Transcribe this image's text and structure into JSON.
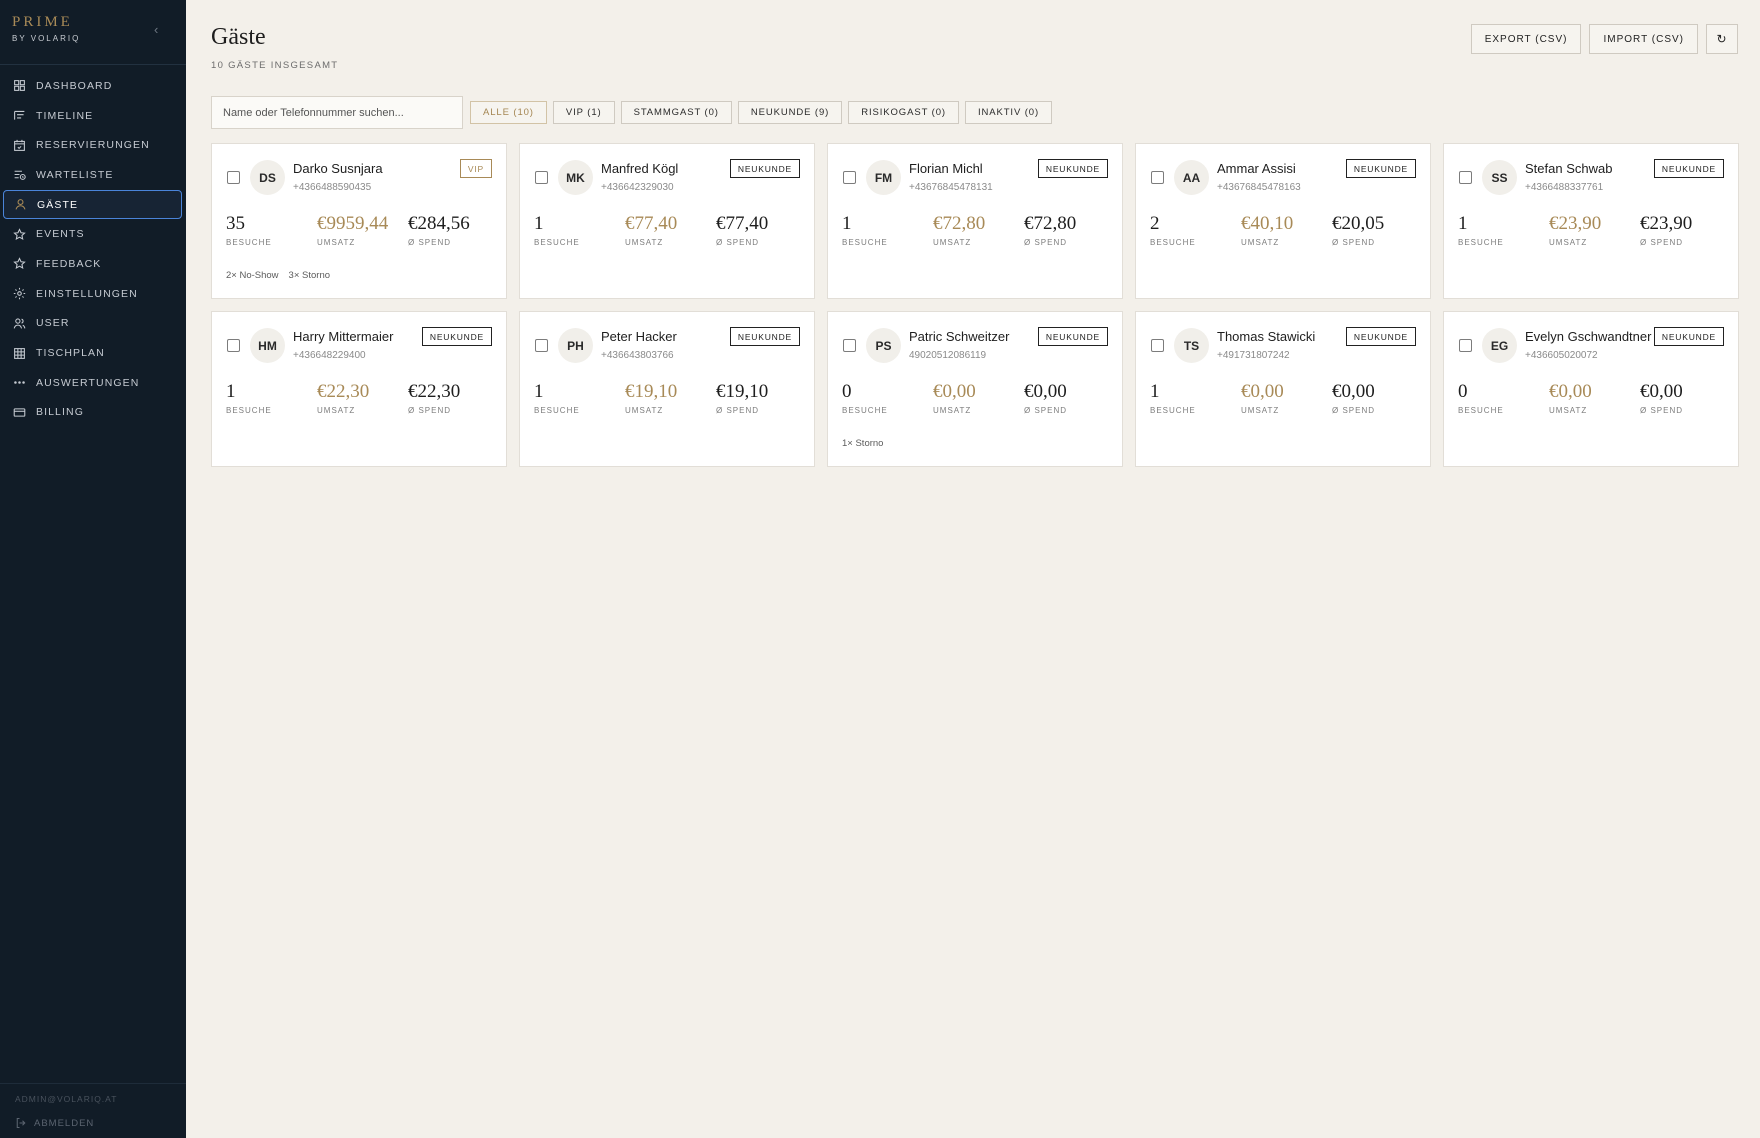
{
  "brand": {
    "name": "PRIME",
    "sub": "BY VOLARIQ"
  },
  "sidebar": {
    "collapse": "‹",
    "items": [
      {
        "label": "DASHBOARD",
        "icon": "grid-icon"
      },
      {
        "label": "TIMELINE",
        "icon": "timeline-icon"
      },
      {
        "label": "RESERVIERUNGEN",
        "icon": "calendar-icon"
      },
      {
        "label": "WARTELISTE",
        "icon": "list-clock-icon"
      },
      {
        "label": "GÄSTE",
        "icon": "user-icon",
        "active": true
      },
      {
        "label": "EVENTS",
        "icon": "star-icon"
      },
      {
        "label": "FEEDBACK",
        "icon": "star-icon"
      },
      {
        "label": "EINSTELLUNGEN",
        "icon": "gear-icon"
      },
      {
        "label": "USER",
        "icon": "users-icon"
      },
      {
        "label": "TISCHPLAN",
        "icon": "table-grid-icon"
      },
      {
        "label": "AUSWERTUNGEN",
        "icon": "dots-icon"
      },
      {
        "label": "BILLING",
        "icon": "credit-card-icon"
      }
    ],
    "email": "ADMIN@VOLARIQ.AT",
    "logout": "ABMELDEN"
  },
  "header": {
    "title": "Gäste",
    "subtitle": "10 GÄSTE INSGESAMT",
    "export": "EXPORT (CSV)",
    "import": "IMPORT (CSV)",
    "refresh": "↻"
  },
  "search": {
    "placeholder": "Name oder Telefonnummer suchen...",
    "value": ""
  },
  "filters": [
    {
      "label": "ALLE (10)",
      "active": true
    },
    {
      "label": "VIP (1)"
    },
    {
      "label": "STAMMGAST (0)"
    },
    {
      "label": "NEUKUNDE (9)"
    },
    {
      "label": "RISIKOGAST (0)"
    },
    {
      "label": "INAKTIV (0)"
    }
  ],
  "labels": {
    "visits": "BESUCHE",
    "revenue": "UMSATZ",
    "spend": "Ø SPEND"
  },
  "colors": {
    "sidebar": "#111c27",
    "accent_gold": "#a88a57",
    "background": "#f3f0ea",
    "active_border": "#4a84d9"
  },
  "guests": [
    {
      "initials": "DS",
      "name": "Darko Susnjara",
      "phone": "+4366488590435",
      "badge": "VIP",
      "visits": "35",
      "revenue": "€9959,44",
      "spend": "€284,56",
      "notes": [
        "2× No-Show",
        "3× Storno"
      ]
    },
    {
      "initials": "MK",
      "name": "Manfred Kögl",
      "phone": "+436642329030",
      "badge": "NEUKUNDE",
      "visits": "1",
      "revenue": "€77,40",
      "spend": "€77,40",
      "notes": []
    },
    {
      "initials": "FM",
      "name": "Florian Michl",
      "phone": "+43676845478131",
      "badge": "NEUKUNDE",
      "visits": "1",
      "revenue": "€72,80",
      "spend": "€72,80",
      "notes": []
    },
    {
      "initials": "AA",
      "name": "Ammar Assisi",
      "phone": "+43676845478163",
      "badge": "NEUKUNDE",
      "visits": "2",
      "revenue": "€40,10",
      "spend": "€20,05",
      "notes": []
    },
    {
      "initials": "SS",
      "name": "Stefan Schwab",
      "phone": "+4366488337761",
      "badge": "NEUKUNDE",
      "visits": "1",
      "revenue": "€23,90",
      "spend": "€23,90",
      "notes": []
    },
    {
      "initials": "HM",
      "name": "Harry Mittermaier",
      "phone": "+436648229400",
      "badge": "NEUKUNDE",
      "visits": "1",
      "revenue": "€22,30",
      "spend": "€22,30",
      "notes": []
    },
    {
      "initials": "PH",
      "name": "Peter Hacker",
      "phone": "+436643803766",
      "badge": "NEUKUNDE",
      "visits": "1",
      "revenue": "€19,10",
      "spend": "€19,10",
      "notes": []
    },
    {
      "initials": "PS",
      "name": "Patric Schweitzer",
      "phone": "49020512086119",
      "badge": "NEUKUNDE",
      "visits": "0",
      "revenue": "€0,00",
      "spend": "€0,00",
      "notes": [
        "1× Storno"
      ]
    },
    {
      "initials": "TS",
      "name": "Thomas Stawicki",
      "phone": "+491731807242",
      "badge": "NEUKUNDE",
      "visits": "1",
      "revenue": "€0,00",
      "spend": "€0,00",
      "notes": []
    },
    {
      "initials": "EG",
      "name": "Evelyn Gschwandtner",
      "phone": "+436605020072",
      "badge": "NEUKUNDE",
      "visits": "0",
      "revenue": "€0,00",
      "spend": "€0,00",
      "notes": []
    }
  ]
}
